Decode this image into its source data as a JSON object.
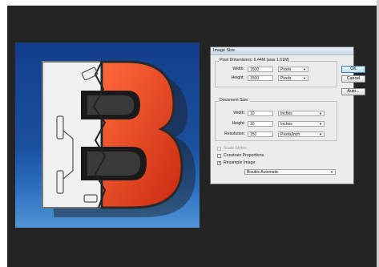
{
  "dialog": {
    "title": "Image Size",
    "pixel_dimensions_label": "Pixel Dimensions: 6.44M (was 1.61M)",
    "width_label": "Width:",
    "width_value": "1500",
    "width_unit": "Pixels",
    "height_label": "Height:",
    "height_value": "1500",
    "height_unit": "Pixels",
    "document_size_label": "Document Size:",
    "doc_width_label": "Width:",
    "doc_width_value": "10",
    "doc_width_unit": "Inches",
    "doc_height_label": "Height:",
    "doc_height_value": "10",
    "doc_height_unit": "Inches",
    "resolution_label": "Resolution:",
    "resolution_value": "150",
    "resolution_unit": "Pixels/Inch",
    "scale_styles_label": "Scale Styles",
    "scale_styles_checked": false,
    "constrain_label": "Constrain Proportions",
    "constrain_checked": false,
    "resample_label": "Resample Image:",
    "resample_checked": true,
    "resample_method": "Bicubic Automatic",
    "ok_label": "OK",
    "cancel_label": "Cancel",
    "auto_label": "Auto..."
  },
  "canvas": {
    "subject": "letter-b-artwork",
    "colors": {
      "background": "#1a4f9e",
      "letter_red": "#e63a1c",
      "letter_white": "#f2f2f2"
    }
  }
}
